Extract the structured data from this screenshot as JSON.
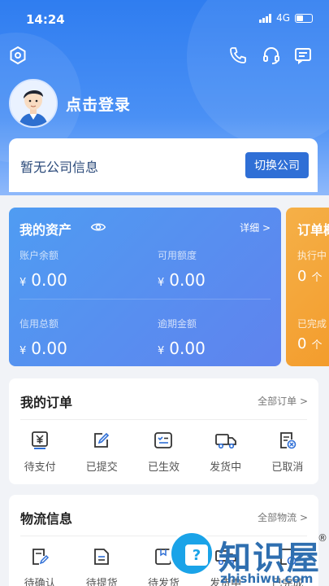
{
  "status_bar": {
    "time": "14:24",
    "network": "4G"
  },
  "header": {
    "login_text": "点击登录"
  },
  "company": {
    "label": "暂无公司信息",
    "switch_button": "切换公司"
  },
  "assets": {
    "title": "我的资产",
    "detail": "详细 >",
    "balance_label": "账户余额",
    "balance_value": "0.00",
    "available_label": "可用额度",
    "available_value": "0.00",
    "credit_label": "信用总额",
    "credit_value": "0.00",
    "overdue_label": "逾期金额",
    "overdue_value": "0.00",
    "currency": "¥"
  },
  "order_stats": {
    "title": "订单概",
    "executing_label": "执行中",
    "executing_value": "0",
    "completed_label": "已完成",
    "completed_value": "0",
    "unit": "个"
  },
  "my_orders": {
    "title": "我的订单",
    "more": "全部订单 >",
    "items": [
      {
        "label": "待支付",
        "icon": "yuan-doc-icon"
      },
      {
        "label": "已提交",
        "icon": "edit-doc-icon"
      },
      {
        "label": "已生效",
        "icon": "checklist-icon"
      },
      {
        "label": "发货中",
        "icon": "truck-icon"
      },
      {
        "label": "已取消",
        "icon": "cancel-doc-icon"
      }
    ]
  },
  "logistics": {
    "title": "物流信息",
    "more": "全部物流 >",
    "items": [
      {
        "label": "待确认",
        "icon": "edit-doc-icon"
      },
      {
        "label": "待提货",
        "icon": "doc-icon"
      },
      {
        "label": "待发货",
        "icon": "box-icon"
      },
      {
        "label": "发货中",
        "icon": "truck-icon"
      },
      {
        "label": "已完成",
        "icon": "check-doc-icon"
      }
    ]
  },
  "watermark": {
    "brand": "知识屋",
    "registered": "®",
    "url": "zhishiwu.com"
  },
  "colors": {
    "primary": "#2f6fd6",
    "asset_card": "#5a8ef0",
    "order_card": "#f5a73a"
  }
}
